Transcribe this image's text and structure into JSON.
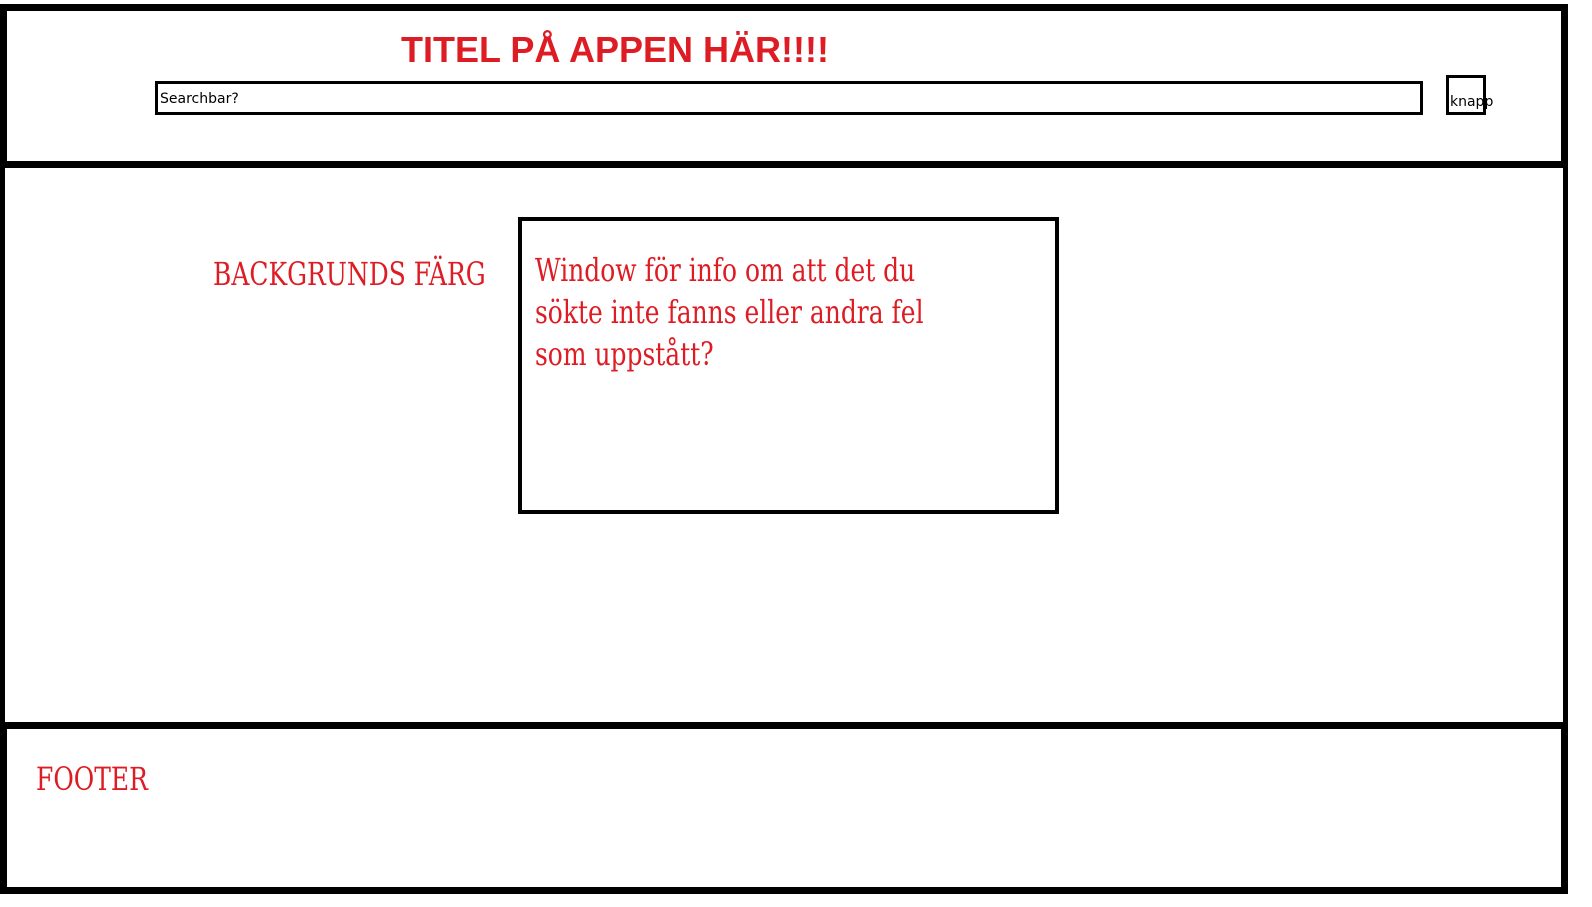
{
  "header": {
    "title": "TITEL PÅ APPEN HÄR!!!!",
    "search": {
      "value": "",
      "placeholder": "Searchbar?"
    },
    "button_label": "knapp"
  },
  "main": {
    "background_label": "BACKGRUNDS FÄRG",
    "info_window_text": "Window för info om att det du sökte inte fanns eller andra fel som uppstått?"
  },
  "footer": {
    "label": "FOOTER"
  },
  "colors": {
    "annotation_red": "#dd1c24",
    "border": "#000000",
    "background": "#ffffff"
  }
}
